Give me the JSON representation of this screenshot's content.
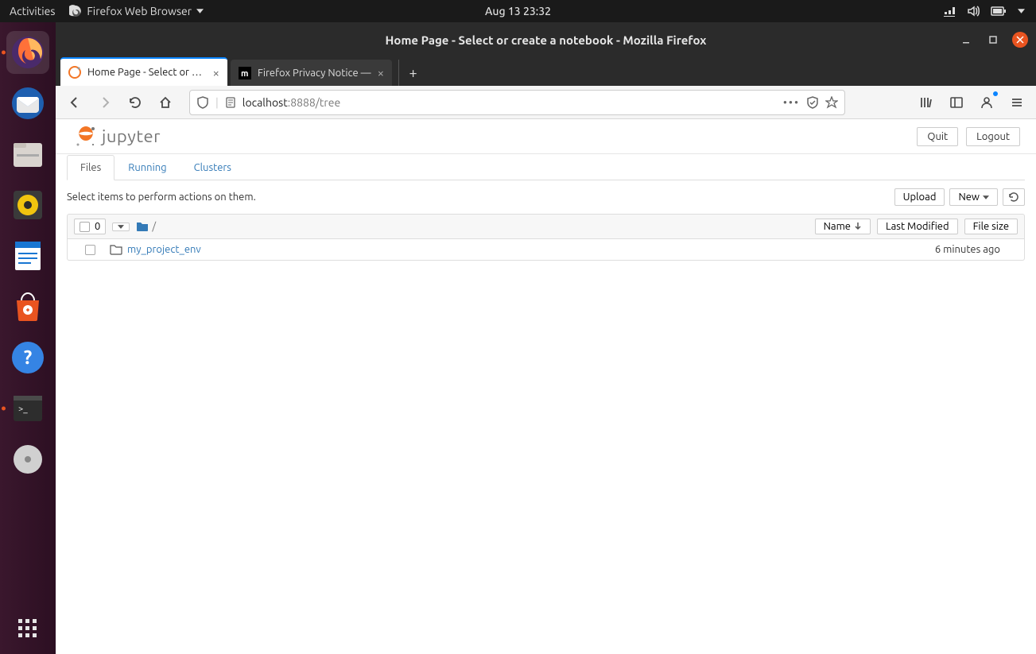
{
  "gnome": {
    "activities": "Activities",
    "app_menu": "Firefox Web Browser",
    "clock": "Aug 13  23:32"
  },
  "dock": {
    "items": [
      "firefox",
      "thunderbird",
      "files",
      "rhythmbox",
      "writer",
      "software",
      "help",
      "terminal",
      "disk"
    ]
  },
  "firefox": {
    "window_title": "Home Page - Select or create a notebook - Mozilla Firefox",
    "tabs": [
      {
        "label": "Home Page - Select or cr…",
        "active": true
      },
      {
        "label": "Firefox Privacy Notice —",
        "active": false
      }
    ],
    "url_host": "localhost",
    "url_port": ":8888",
    "url_path": "/tree"
  },
  "jupyter": {
    "logo_text": "jupyter",
    "quit": "Quit",
    "logout": "Logout",
    "tabs": [
      {
        "label": "Files",
        "active": true
      },
      {
        "label": "Running",
        "active": false
      },
      {
        "label": "Clusters",
        "active": false
      }
    ],
    "hint": "Select items to perform actions on them.",
    "upload": "Upload",
    "new": "New",
    "selected_count": "0",
    "breadcrumb_root": "/",
    "col_name": "Name",
    "col_modified": "Last Modified",
    "col_size": "File size",
    "rows": [
      {
        "name": "my_project_env",
        "modified": "6 minutes ago",
        "size": ""
      }
    ]
  }
}
